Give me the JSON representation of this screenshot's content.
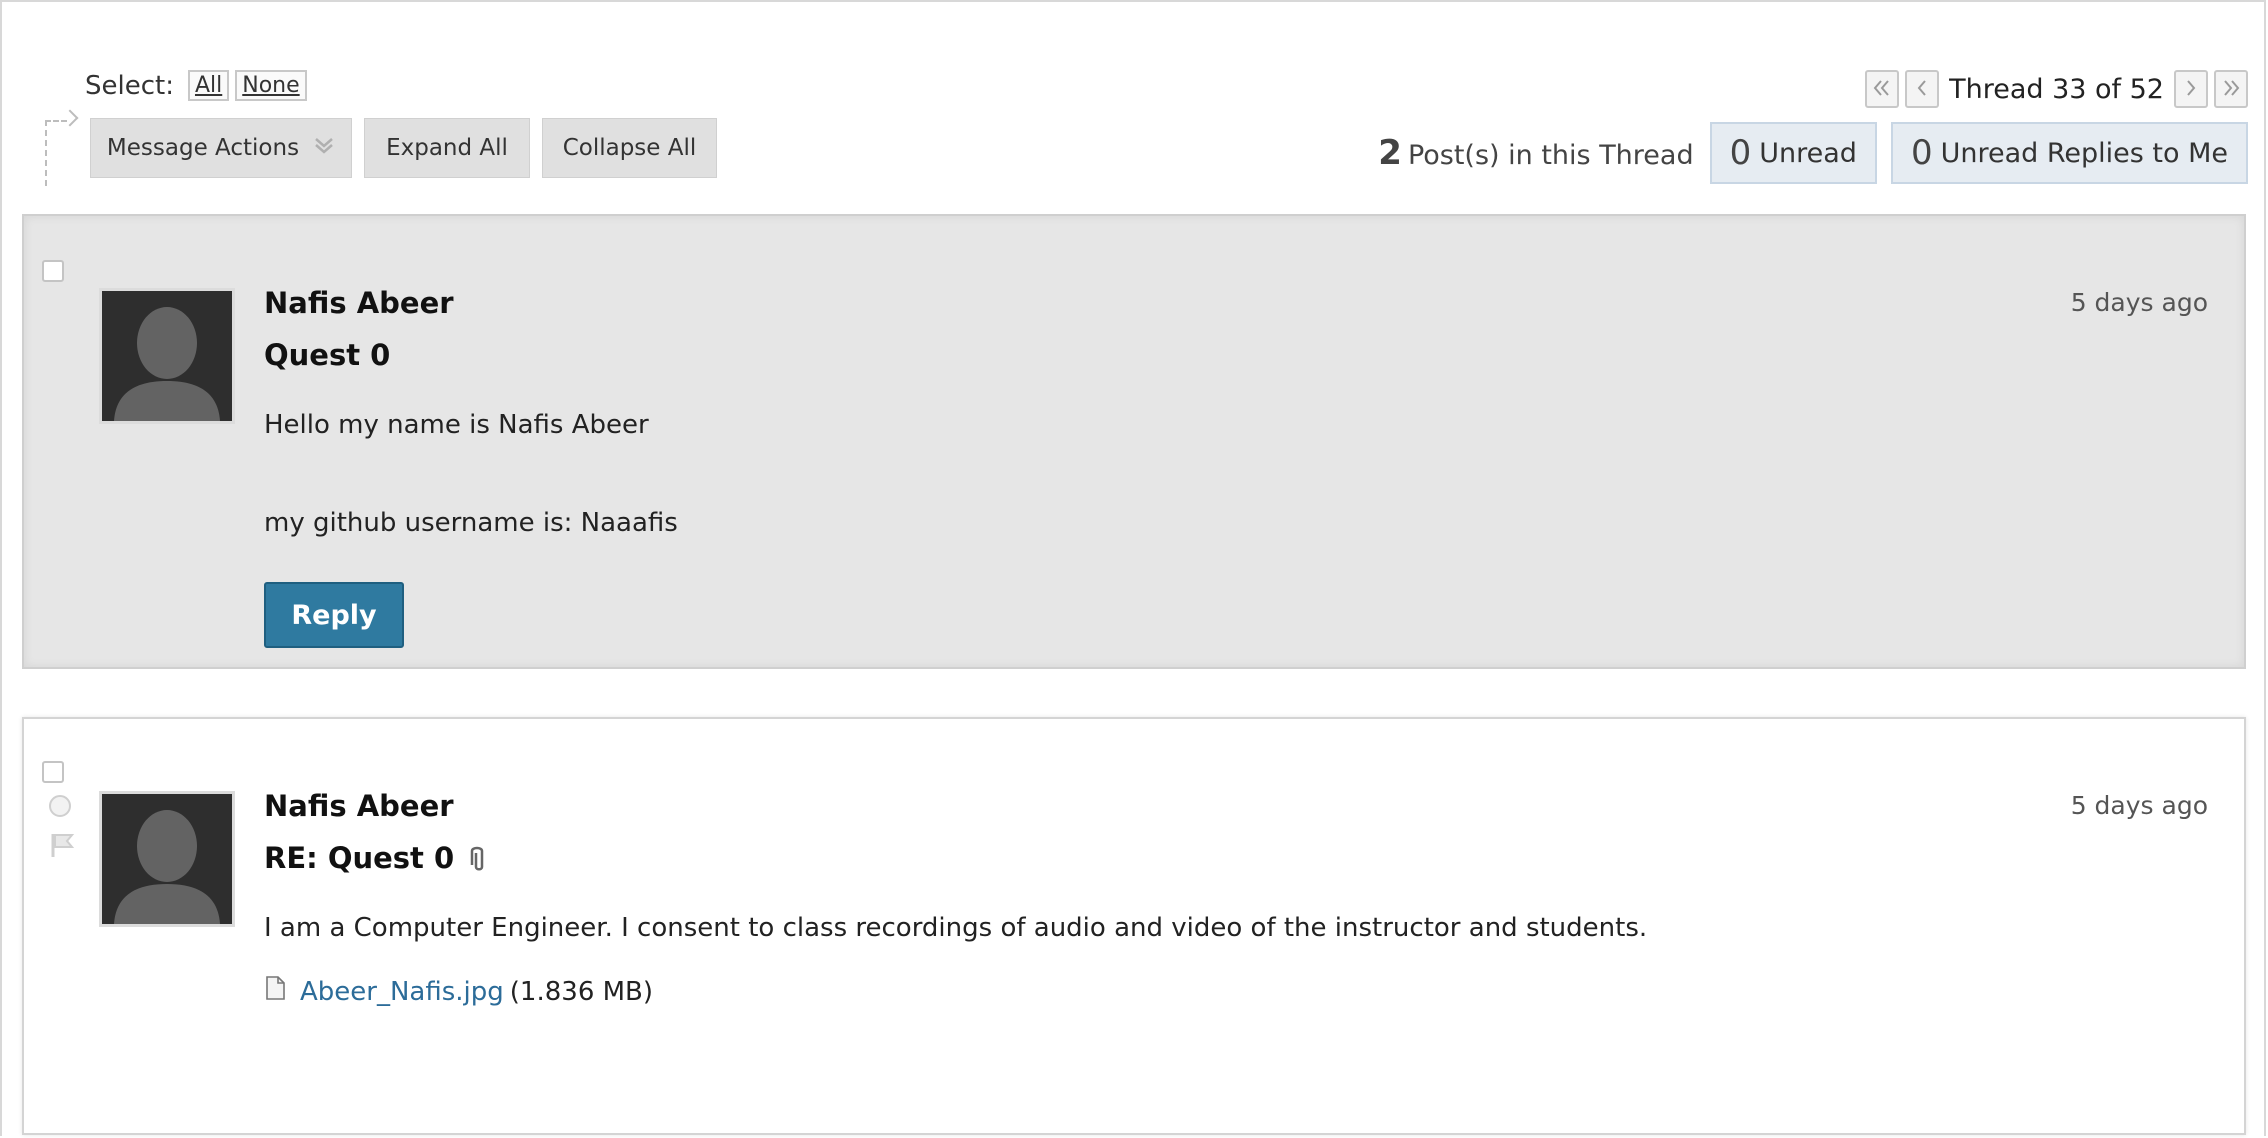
{
  "toolbar": {
    "select_label": "Select:",
    "select_all": "All",
    "select_none": "None",
    "message_actions": "Message Actions",
    "expand_all": "Expand All",
    "collapse_all": "Collapse All"
  },
  "pager": {
    "thread_text": "Thread 33 of 52",
    "first_icon": "double-chevron-left-icon",
    "prev_icon": "chevron-left-icon",
    "next_icon": "chevron-right-icon",
    "last_icon": "double-chevron-right-icon"
  },
  "counts": {
    "posts_number": "2",
    "posts_label": "Post(s) in this Thread",
    "unread_number": "0",
    "unread_label": "Unread",
    "replies_number": "0",
    "replies_label": "Unread Replies to Me"
  },
  "posts": [
    {
      "author": "Nafis Abeer",
      "subject": "Quest 0",
      "time": "5 days ago",
      "body_lines": [
        "Hello my name is Nafis Abeer",
        "my github username is: Naaafis"
      ],
      "reply_label": "Reply"
    },
    {
      "author": "Nafis Abeer",
      "subject": "RE: Quest 0",
      "time": "5 days ago",
      "body_lines": [
        "I am a Computer Engineer. I consent to class recordings of audio and video of the instructor and students."
      ],
      "attachment": {
        "name": "Abeer_Nafis.jpg",
        "size": "(1.836 MB)"
      }
    }
  ],
  "colors": {
    "reply_button": "#2f7aa0",
    "link": "#2c6c99",
    "post_highlight_bg": "#e6e6e6",
    "count_box_bg": "#e6ecf2"
  }
}
